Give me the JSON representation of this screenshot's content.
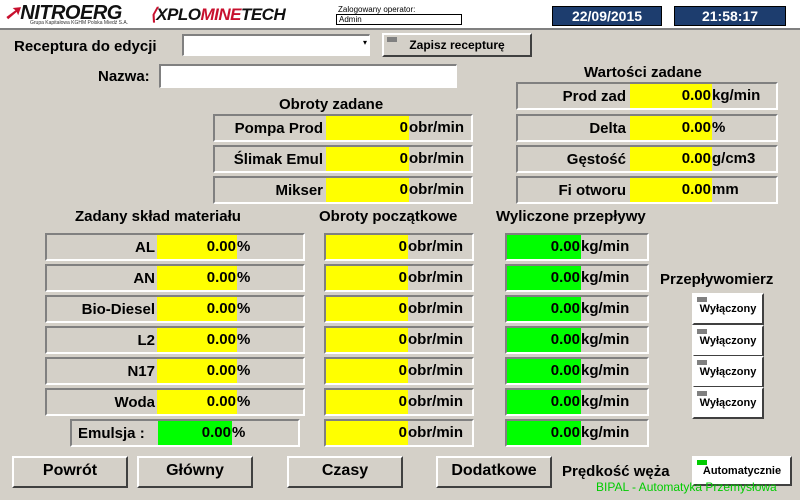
{
  "header": {
    "logo_main": "NITROERG",
    "logo_sub": "Grupa Kapitałowa KGHM Polska Miedź S.A.",
    "logo2_pre": "XPLO",
    "logo2_mid": "MINE",
    "logo2_post": "TECH",
    "operator_label": "Zalogowany operator:",
    "operator_value": "Admin",
    "date": "22/09/2015",
    "time": "21:58:17"
  },
  "recipe": {
    "label": "Receptura do edycji",
    "select_value": "",
    "save_button": "Zapisz recepturę",
    "name_label": "Nazwa:",
    "name_value": ""
  },
  "rpm_set": {
    "title": "Obroty zadane",
    "rows": [
      {
        "label": "Pompa Prod",
        "value": "0",
        "unit": "obr/min"
      },
      {
        "label": "Ślimak Emul",
        "value": "0",
        "unit": "obr/min"
      },
      {
        "label": "Mikser",
        "value": "0",
        "unit": "obr/min"
      }
    ]
  },
  "set_values": {
    "title": "Wartości zadane",
    "rows": [
      {
        "label": "Prod zad",
        "value": "0.00",
        "unit": "kg/min"
      },
      {
        "label": "Delta",
        "value": "0.00",
        "unit": "%"
      },
      {
        "label": "Gęstość",
        "value": "0.00",
        "unit": "g/cm3"
      },
      {
        "label": "Fi otworu",
        "value": "0.00",
        "unit": "mm"
      }
    ]
  },
  "composition": {
    "title": "Zadany skład materiału",
    "rows": [
      {
        "label": "AL",
        "value": "0.00",
        "unit": "%"
      },
      {
        "label": "AN",
        "value": "0.00",
        "unit": "%"
      },
      {
        "label": "Bio-Diesel",
        "value": "0.00",
        "unit": "%"
      },
      {
        "label": "L2",
        "value": "0.00",
        "unit": "%"
      },
      {
        "label": "N17",
        "value": "0.00",
        "unit": "%"
      },
      {
        "label": "Woda",
        "value": "0.00",
        "unit": "%"
      }
    ],
    "emulsion": {
      "label": "Emulsja :",
      "value": "0.00",
      "unit": "%"
    }
  },
  "initial_rpm": {
    "title": "Obroty początkowe",
    "rows": [
      {
        "value": "0",
        "unit": "obr/min"
      },
      {
        "value": "0",
        "unit": "obr/min"
      },
      {
        "value": "0",
        "unit": "obr/min"
      },
      {
        "value": "0",
        "unit": "obr/min"
      },
      {
        "value": "0",
        "unit": "obr/min"
      },
      {
        "value": "0",
        "unit": "obr/min"
      },
      {
        "value": "0",
        "unit": "obr/min"
      }
    ]
  },
  "flows": {
    "title": "Wyliczone przepływy",
    "rows": [
      {
        "value": "0.00",
        "unit": "kg/min"
      },
      {
        "value": "0.00",
        "unit": "kg/min"
      },
      {
        "value": "0.00",
        "unit": "kg/min"
      },
      {
        "value": "0.00",
        "unit": "kg/min"
      },
      {
        "value": "0.00",
        "unit": "kg/min"
      },
      {
        "value": "0.00",
        "unit": "kg/min"
      },
      {
        "value": "0.00",
        "unit": "kg/min"
      }
    ]
  },
  "flowmeter": {
    "title": "Przepływomierz",
    "toggles": [
      "Wyłączony",
      "Wyłączony",
      "Wyłączony",
      "Wyłączony"
    ]
  },
  "nav": {
    "back": "Powrót",
    "main": "Główny",
    "times": "Czasy",
    "extra": "Dodatkowe",
    "auger_label": "Prędkość węża",
    "auger_mode": "Automatycznie"
  },
  "footer": "BIPAL - Automatyka Przemysłowa",
  "colors": {
    "input_yellow": "#ffff00",
    "flow_green": "#00ff00",
    "datetime_bg": "#1d3d6e",
    "footer_green": "#00cc00"
  }
}
